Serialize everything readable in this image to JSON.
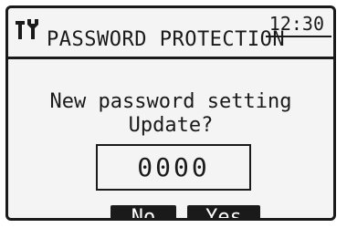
{
  "header": {
    "title": "PASSWORD PROTECTION",
    "time": "12:30",
    "icon": "tools-icon"
  },
  "prompt": {
    "line1": "New password setting",
    "line2": "Update?"
  },
  "password": {
    "value": "0000"
  },
  "buttons": {
    "no": "No",
    "yes": "Yes"
  }
}
